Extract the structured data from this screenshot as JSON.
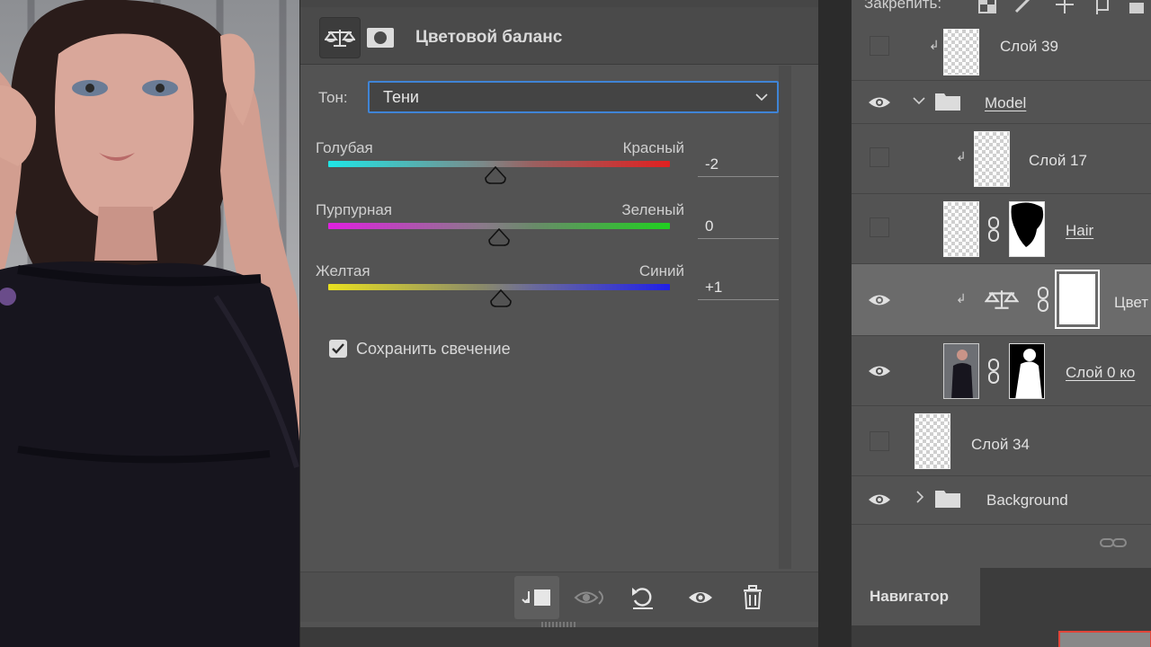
{
  "properties": {
    "title": "Цветовой баланс",
    "tone_label": "Тон:",
    "tone_value": "Тени",
    "sliders": [
      {
        "left": "Голубая",
        "right": "Красный",
        "value": "-2",
        "level": -2
      },
      {
        "left": "Пурпурная",
        "right": "Зеленый",
        "value": "0",
        "level": 0
      },
      {
        "left": "Желтая",
        "right": "Синий",
        "value": "+1",
        "level": 1
      }
    ],
    "preserve_luminosity_label": "Сохранить свечение",
    "preserve_luminosity_checked": true,
    "footer_icons": [
      "clip-to-layer-icon",
      "view-previous-state-icon",
      "reset-icon",
      "visibility-eye-icon",
      "trash-icon"
    ]
  },
  "layers": {
    "lock_label": "Закрепить:",
    "items": [
      {
        "name": "Слой 39",
        "visible": false,
        "clipped": true,
        "kind": "pixel"
      },
      {
        "name": "Model",
        "visible": true,
        "kind": "group",
        "expanded": true
      },
      {
        "name": "Слой 17",
        "visible": false,
        "clipped": true,
        "kind": "pixel"
      },
      {
        "name": "Hair",
        "visible": false,
        "kind": "masked"
      },
      {
        "name": "Цвет",
        "visible": true,
        "clipped": true,
        "kind": "adjustment",
        "selected": true
      },
      {
        "name": "Слой 0 ко",
        "visible": true,
        "kind": "masked"
      },
      {
        "name": "Слой 34",
        "visible": false,
        "kind": "pixel"
      },
      {
        "name": "Background",
        "visible": true,
        "kind": "group",
        "expanded": false
      }
    ]
  },
  "navigator": {
    "tab_label": "Навигатор"
  },
  "colors": {
    "accent": "#3f84d6",
    "panel": "#535353",
    "nav_frame": "#e0453a"
  }
}
